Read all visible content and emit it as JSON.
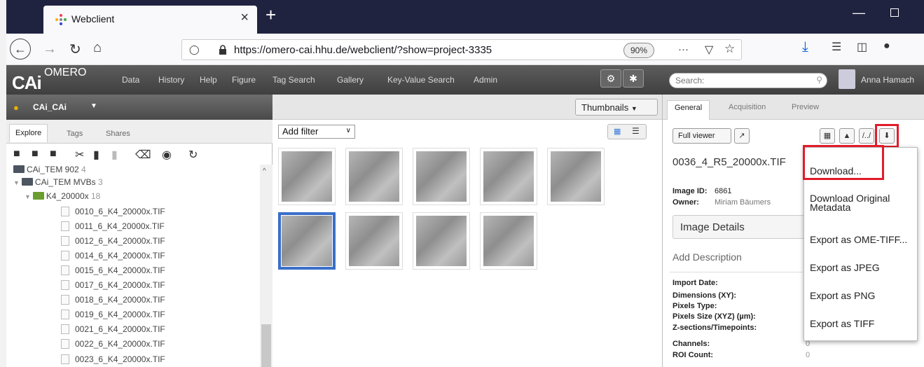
{
  "browser": {
    "tab_title": "Webclient",
    "tab_close": "×",
    "new_tab": "+",
    "url": "https://omero-cai.hhu.de/webclient/?show=project-3335",
    "zoom": "90%",
    "more": "···"
  },
  "omero": {
    "logo_main": "CAi",
    "logo_sub": "OMERO",
    "menu": [
      "Data",
      "History",
      "Help",
      "Figure",
      "Tag Search",
      "Gallery",
      "Key-Value Search",
      "Admin"
    ],
    "search_placeholder": "Search:",
    "user": "Anna Hamach"
  },
  "left": {
    "group": "CAi_CAi",
    "tabs": [
      "Explore",
      "Tags",
      "Shares"
    ],
    "tree": [
      {
        "label": "CAi_TEM 902",
        "count": "4",
        "kind": "folder"
      },
      {
        "label": "CAi_TEM MVBs",
        "count": "3",
        "kind": "folder"
      },
      {
        "label": "K4_20000x",
        "count": "18",
        "kind": "green"
      },
      {
        "label": "0010_6_K4_20000x.TIF",
        "kind": "file"
      },
      {
        "label": "0011_6_K4_20000x.TIF",
        "kind": "file"
      },
      {
        "label": "0012_6_K4_20000x.TIF",
        "kind": "file"
      },
      {
        "label": "0014_6_K4_20000x.TIF",
        "kind": "file"
      },
      {
        "label": "0015_6_K4_20000x.TIF",
        "kind": "file"
      },
      {
        "label": "0017_6_K4_20000x.TIF",
        "kind": "file"
      },
      {
        "label": "0018_6_K4_20000x.TIF",
        "kind": "file"
      },
      {
        "label": "0019_6_K4_20000x.TIF",
        "kind": "file"
      },
      {
        "label": "0021_6_K4_20000x.TIF",
        "kind": "file"
      },
      {
        "label": "0022_6_K4_20000x.TIF",
        "kind": "file"
      },
      {
        "label": "0023_6_K4_20000x.TIF",
        "kind": "file"
      }
    ]
  },
  "center": {
    "view_select": "Thumbnails",
    "filter": "Add filter"
  },
  "right": {
    "tabs": [
      "General",
      "Acquisition",
      "Preview"
    ],
    "full_viewer": "Full viewer",
    "image_name": "0036_4_R5_20000x.TIF",
    "image_id_label": "Image ID:",
    "image_id": "6861",
    "owner_label": "Owner:",
    "owner": "Miriam Bäumers",
    "details": "Image Details",
    "add_description": "Add Description",
    "meta_labels": [
      "Import Date:",
      "Dimensions (XY):",
      "Pixels Type:",
      "Pixels Size (XYZ) (µm):",
      "Z-sections/Timepoints:",
      "Channels:",
      "ROI Count:"
    ],
    "channels": "0",
    "roi_count": "0"
  },
  "download_menu": [
    "Download...",
    "Download Original Metadata",
    "Export as OME-TIFF...",
    "Export as JPEG",
    "Export as PNG",
    "Export as TIFF"
  ],
  "colors": {
    "highlight": "#e21c2a",
    "selection": "#3a6fc9"
  }
}
